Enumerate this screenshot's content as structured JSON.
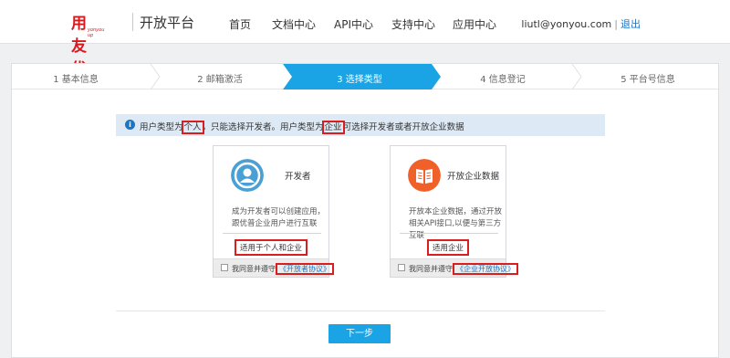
{
  "header": {
    "logo_text": "用友优普",
    "logo_sub": "yonyou up",
    "platform": "开放平台",
    "nav": [
      "首页",
      "文档中心",
      "API中心",
      "支持中心",
      "应用中心"
    ],
    "user_email": "liutl@yonyou.com",
    "separator": "|",
    "logout": "退出"
  },
  "steps": [
    {
      "label": "1 基本信息",
      "active": false
    },
    {
      "label": "2 邮箱激活",
      "active": false
    },
    {
      "label": "3 选择类型",
      "active": true
    },
    {
      "label": "4 信息登记",
      "active": false
    },
    {
      "label": "5 平台号信息",
      "active": false
    }
  ],
  "info": {
    "icon": "i",
    "part1": "用户类型为",
    "highlight1": "个人",
    "part2": "，只能选择开发者。用户类型为",
    "highlight2": "企业",
    "part3": "可选择开发者或者开放企业数据"
  },
  "cards": [
    {
      "title": "开发者",
      "desc": "成为开发者可以创建应用，跟优普企业用户进行互联",
      "tag": "适用于个人和企业",
      "agree_prefix": "我同意并遵守",
      "agree_link": "《开放者协议》",
      "icon": "user-icon",
      "color": "#4aa0d4"
    },
    {
      "title": "开放企业数据",
      "desc": "开放本企业数据，通过开放相关API接口,以便与第三方互联",
      "tag": "适用企业",
      "agree_prefix": "我同意并遵守",
      "agree_link": "《企业开放协议》",
      "icon": "book-icon",
      "color": "#f0612a"
    }
  ],
  "next_button": "下一步",
  "colors": {
    "active_step": "#1aa4e5",
    "highlight": "#d81e1e",
    "link": "#1a73c8"
  }
}
